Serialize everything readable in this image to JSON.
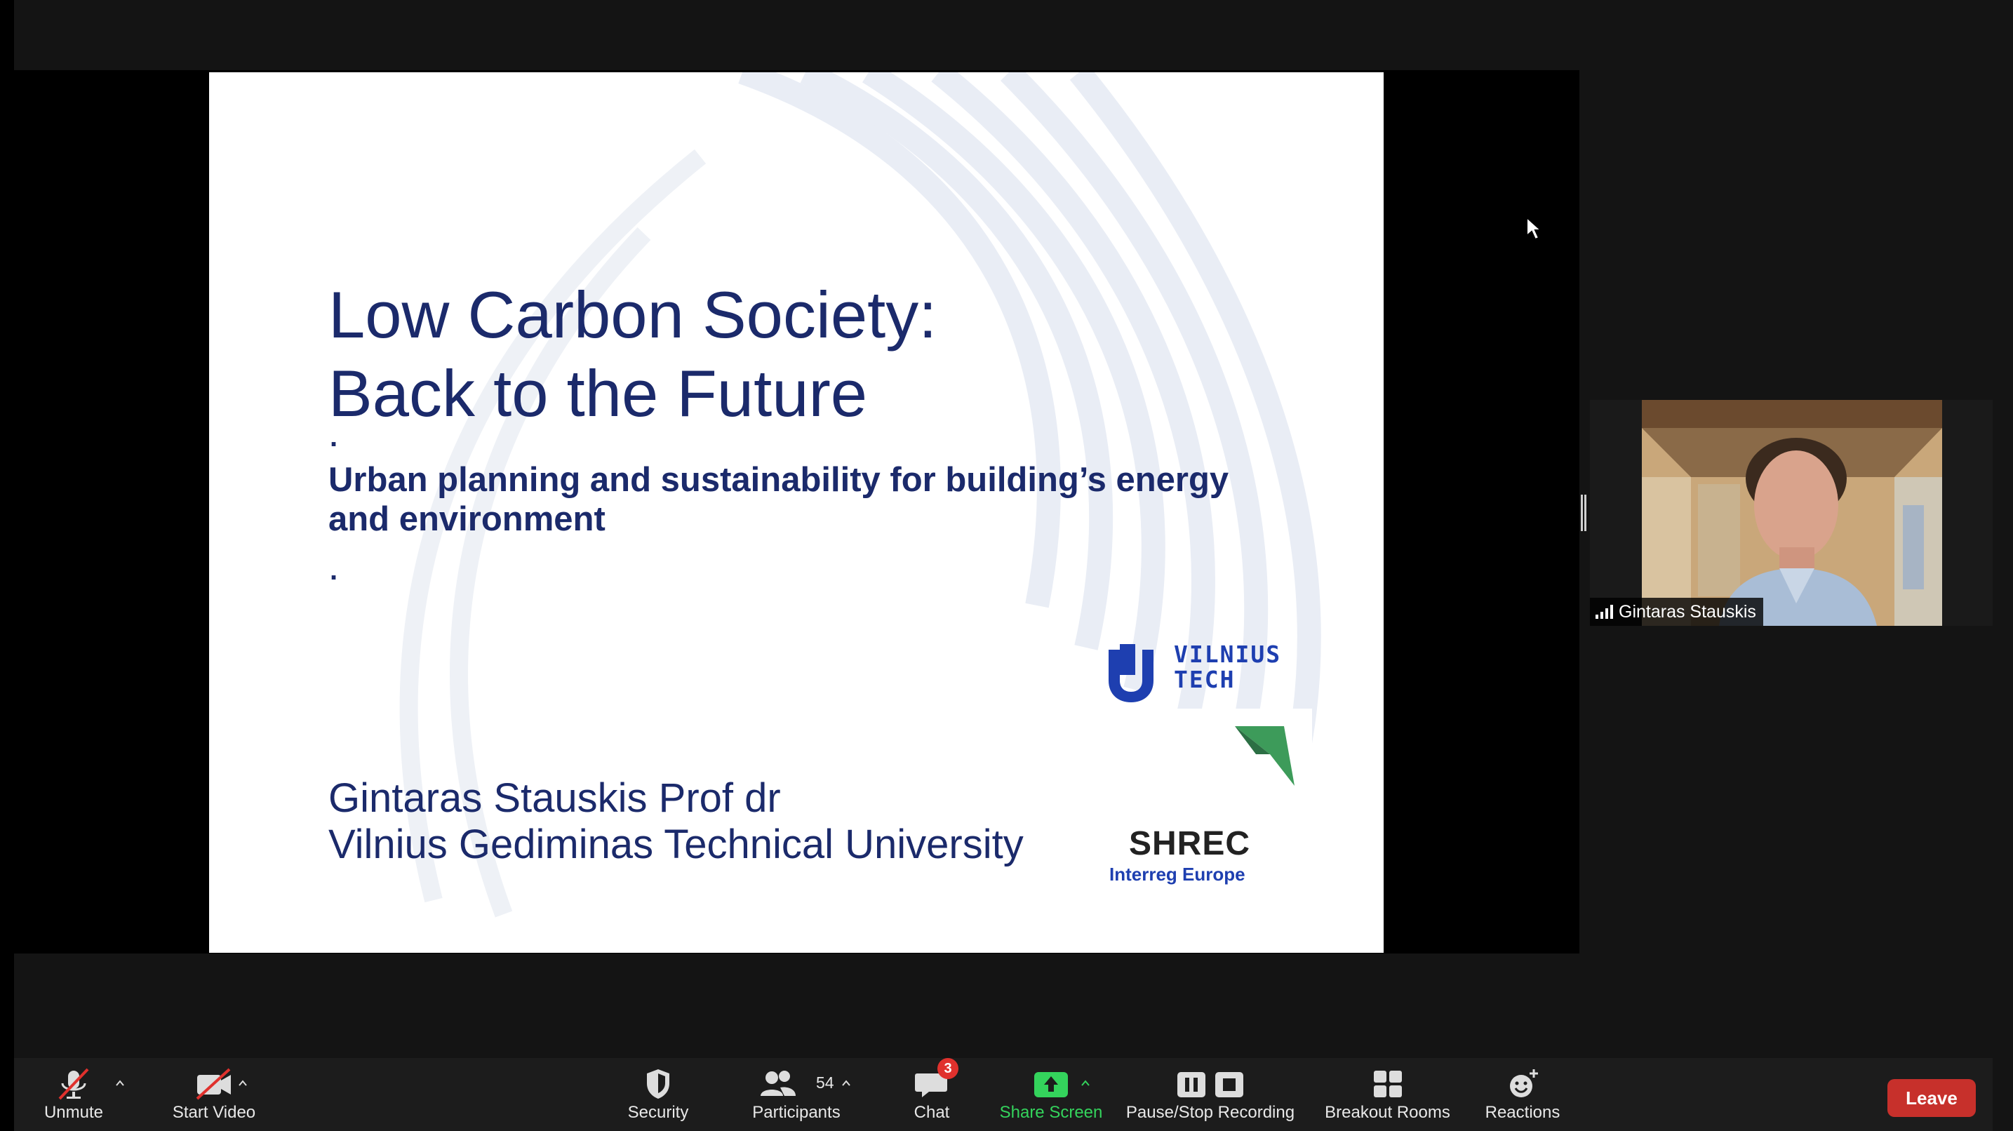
{
  "slide": {
    "title_line1": "Low Carbon Society:",
    "title_line2": "Back to the Future",
    "dot1": ".",
    "subtitle": "Urban planning and sustainability for building’s energy and environment",
    "dot2": ".",
    "author_line1": "Gintaras Stauskis Prof dr",
    "author_line2": "Vilnius Gediminas Technical University",
    "logo1_line1": "VILNIUS",
    "logo1_line2": "TECH",
    "logo2_name": "SHREC",
    "logo2_sub": "Interreg Europe"
  },
  "participant": {
    "name": "Gintaras Stauskis"
  },
  "toolbar": {
    "unmute": "Unmute",
    "start_video": "Start Video",
    "security": "Security",
    "participants": "Participants",
    "participants_count": "54",
    "chat": "Chat",
    "chat_badge": "3",
    "share_screen": "Share Screen",
    "pause_stop_recording": "Pause/Stop Recording",
    "breakout_rooms": "Breakout Rooms",
    "reactions": "Reactions",
    "leave": "Leave"
  },
  "colors": {
    "slide_text": "#1b2a6b",
    "share_green": "#34d35c",
    "leave_red": "#c7302b",
    "badge_red": "#e0312d"
  },
  "icons": [
    "mic-muted-icon",
    "video-off-icon",
    "caret-up-icon",
    "shield-icon",
    "people-icon",
    "chat-bubble-icon",
    "share-screen-icon",
    "pause-icon",
    "stop-icon",
    "grid-icon",
    "smiley-plus-icon",
    "signal-bars-icon",
    "cursor-icon"
  ]
}
